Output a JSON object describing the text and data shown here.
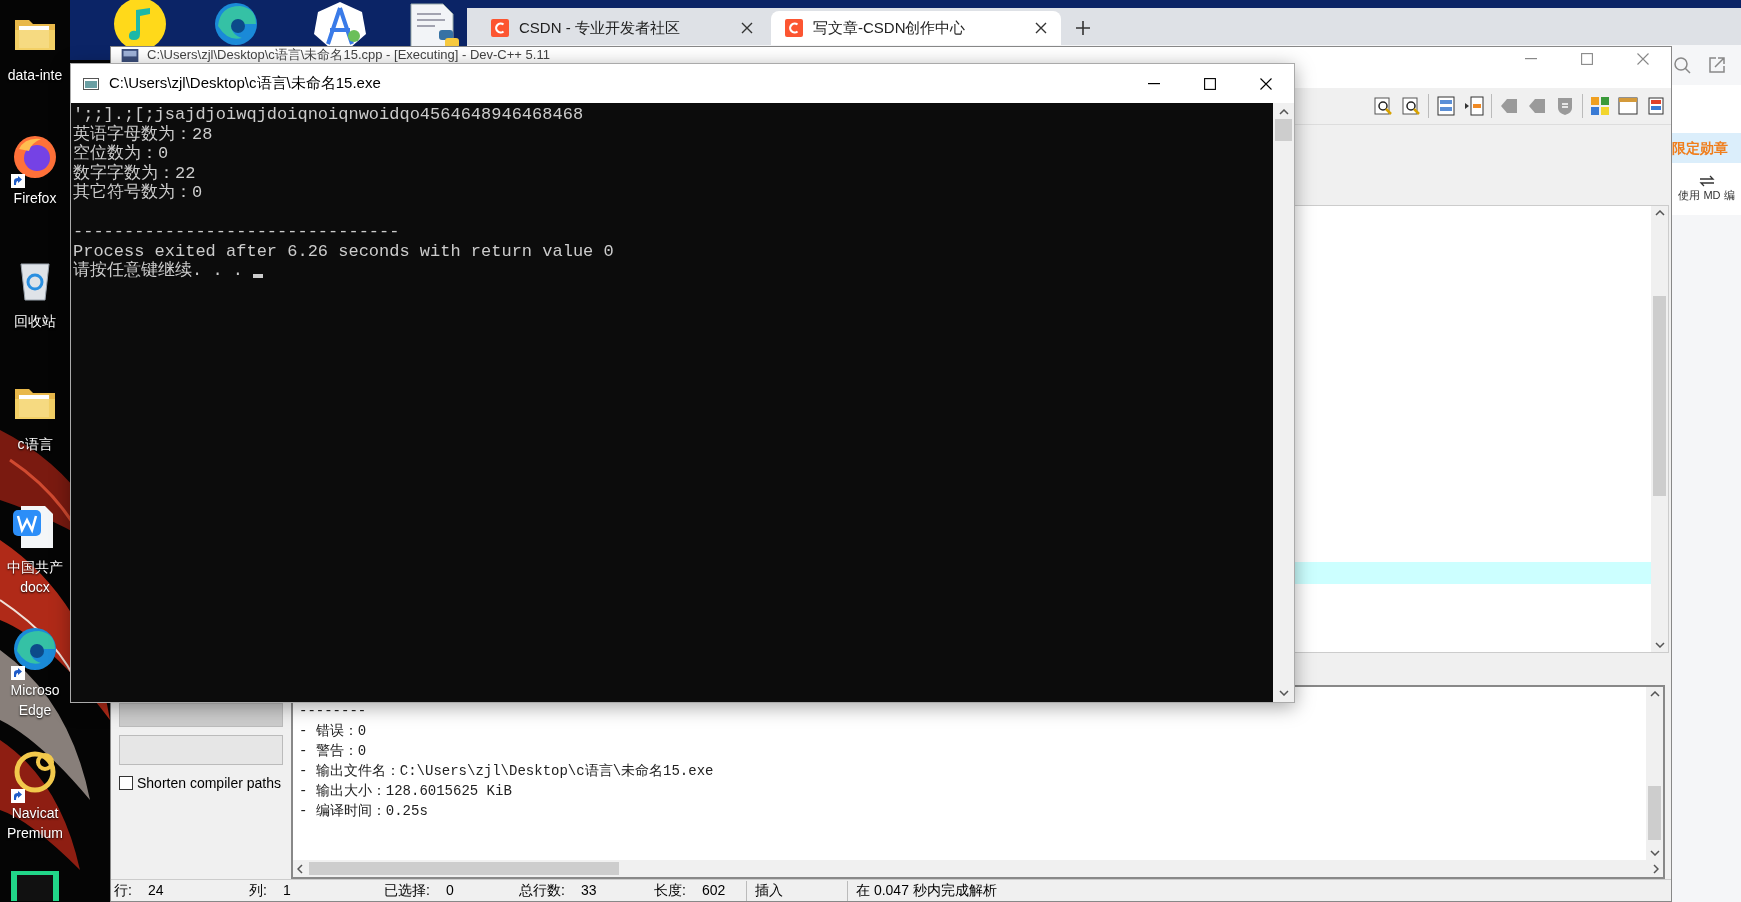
{
  "desktop": {
    "icons": [
      {
        "kind": "folder",
        "shortcut": false,
        "lines": [
          "data-inte"
        ]
      },
      {
        "kind": "firefox",
        "shortcut": true,
        "lines": [
          "Firefox"
        ]
      },
      {
        "kind": "recycle",
        "shortcut": false,
        "lines": [
          "回收站"
        ]
      },
      {
        "kind": "folder",
        "shortcut": false,
        "lines": [
          "c语言"
        ]
      },
      {
        "kind": "document",
        "shortcut": false,
        "lines": [
          "中国共产",
          "docx"
        ]
      },
      {
        "kind": "edge",
        "shortcut": true,
        "lines": [
          "Microso",
          "Edge"
        ]
      },
      {
        "kind": "navicat",
        "shortcut": true,
        "lines": [
          "Navicat",
          "Premium"
        ]
      },
      {
        "kind": "ide",
        "shortcut": false
      }
    ],
    "top_icons": [
      {
        "kind": "music"
      },
      {
        "kind": "edge"
      },
      {
        "kind": "compass"
      },
      {
        "kind": "script"
      }
    ]
  },
  "browser": {
    "tabs": [
      {
        "label": "CSDN - 专业开发者社区",
        "selected": false
      },
      {
        "label": "写文章-CSDN创作中心",
        "selected": true
      }
    ],
    "side": {
      "banner": "限定勋章",
      "toggle_label": "使用 MD 编"
    }
  },
  "devcpp": {
    "title": "C:\\Users\\zjl\\Desktop\\c语言\\未命名15.cpp - [Executing] - Dev-C++ 5.11",
    "compile_panel": {
      "checkbox": {
        "label": "Shorten compiler paths",
        "checked": false
      }
    },
    "log": [
      "--------",
      "- 错误：0",
      "- 警告：0",
      "- 输出文件名：C:\\Users\\zjl\\Desktop\\c语言\\未命名15.exe",
      "- 输出大小：128.6015625 KiB",
      "- 编译时间：0.25s"
    ],
    "status_bar": {
      "fields": [
        {
          "label": "行:",
          "value": "24"
        },
        {
          "label": "列:",
          "value": "1"
        },
        {
          "label": "已选择:",
          "value": "0"
        },
        {
          "label": "总行数:",
          "value": "33"
        },
        {
          "label": "长度:",
          "value": "602"
        }
      ],
      "mode": "插入",
      "message": "在 0.047 秒内完成解析"
    }
  },
  "console": {
    "title": "C:\\Users\\zjl\\Desktop\\c语言\\未命名15.exe",
    "lines": [
      {
        "text": "';;].;[;jsajdjoiwqjdoiqnoiqnwoidqo4564648946468468",
        "gap_before": false
      },
      {
        "text": "英语字母数为：28",
        "gap_before": false
      },
      {
        "text": "空位数为：0",
        "gap_before": false
      },
      {
        "text": "数字字数为：22",
        "gap_before": false
      },
      {
        "text": "其它符号数为：0",
        "gap_before": false
      },
      {
        "text": "--------------------------------",
        "gap_before": true
      },
      {
        "text": "Process exited after 6.26 seconds with return value 0",
        "gap_before": false
      },
      {
        "text": "请按任意键继续. . .",
        "gap_before": false
      }
    ],
    "cursor": true
  }
}
